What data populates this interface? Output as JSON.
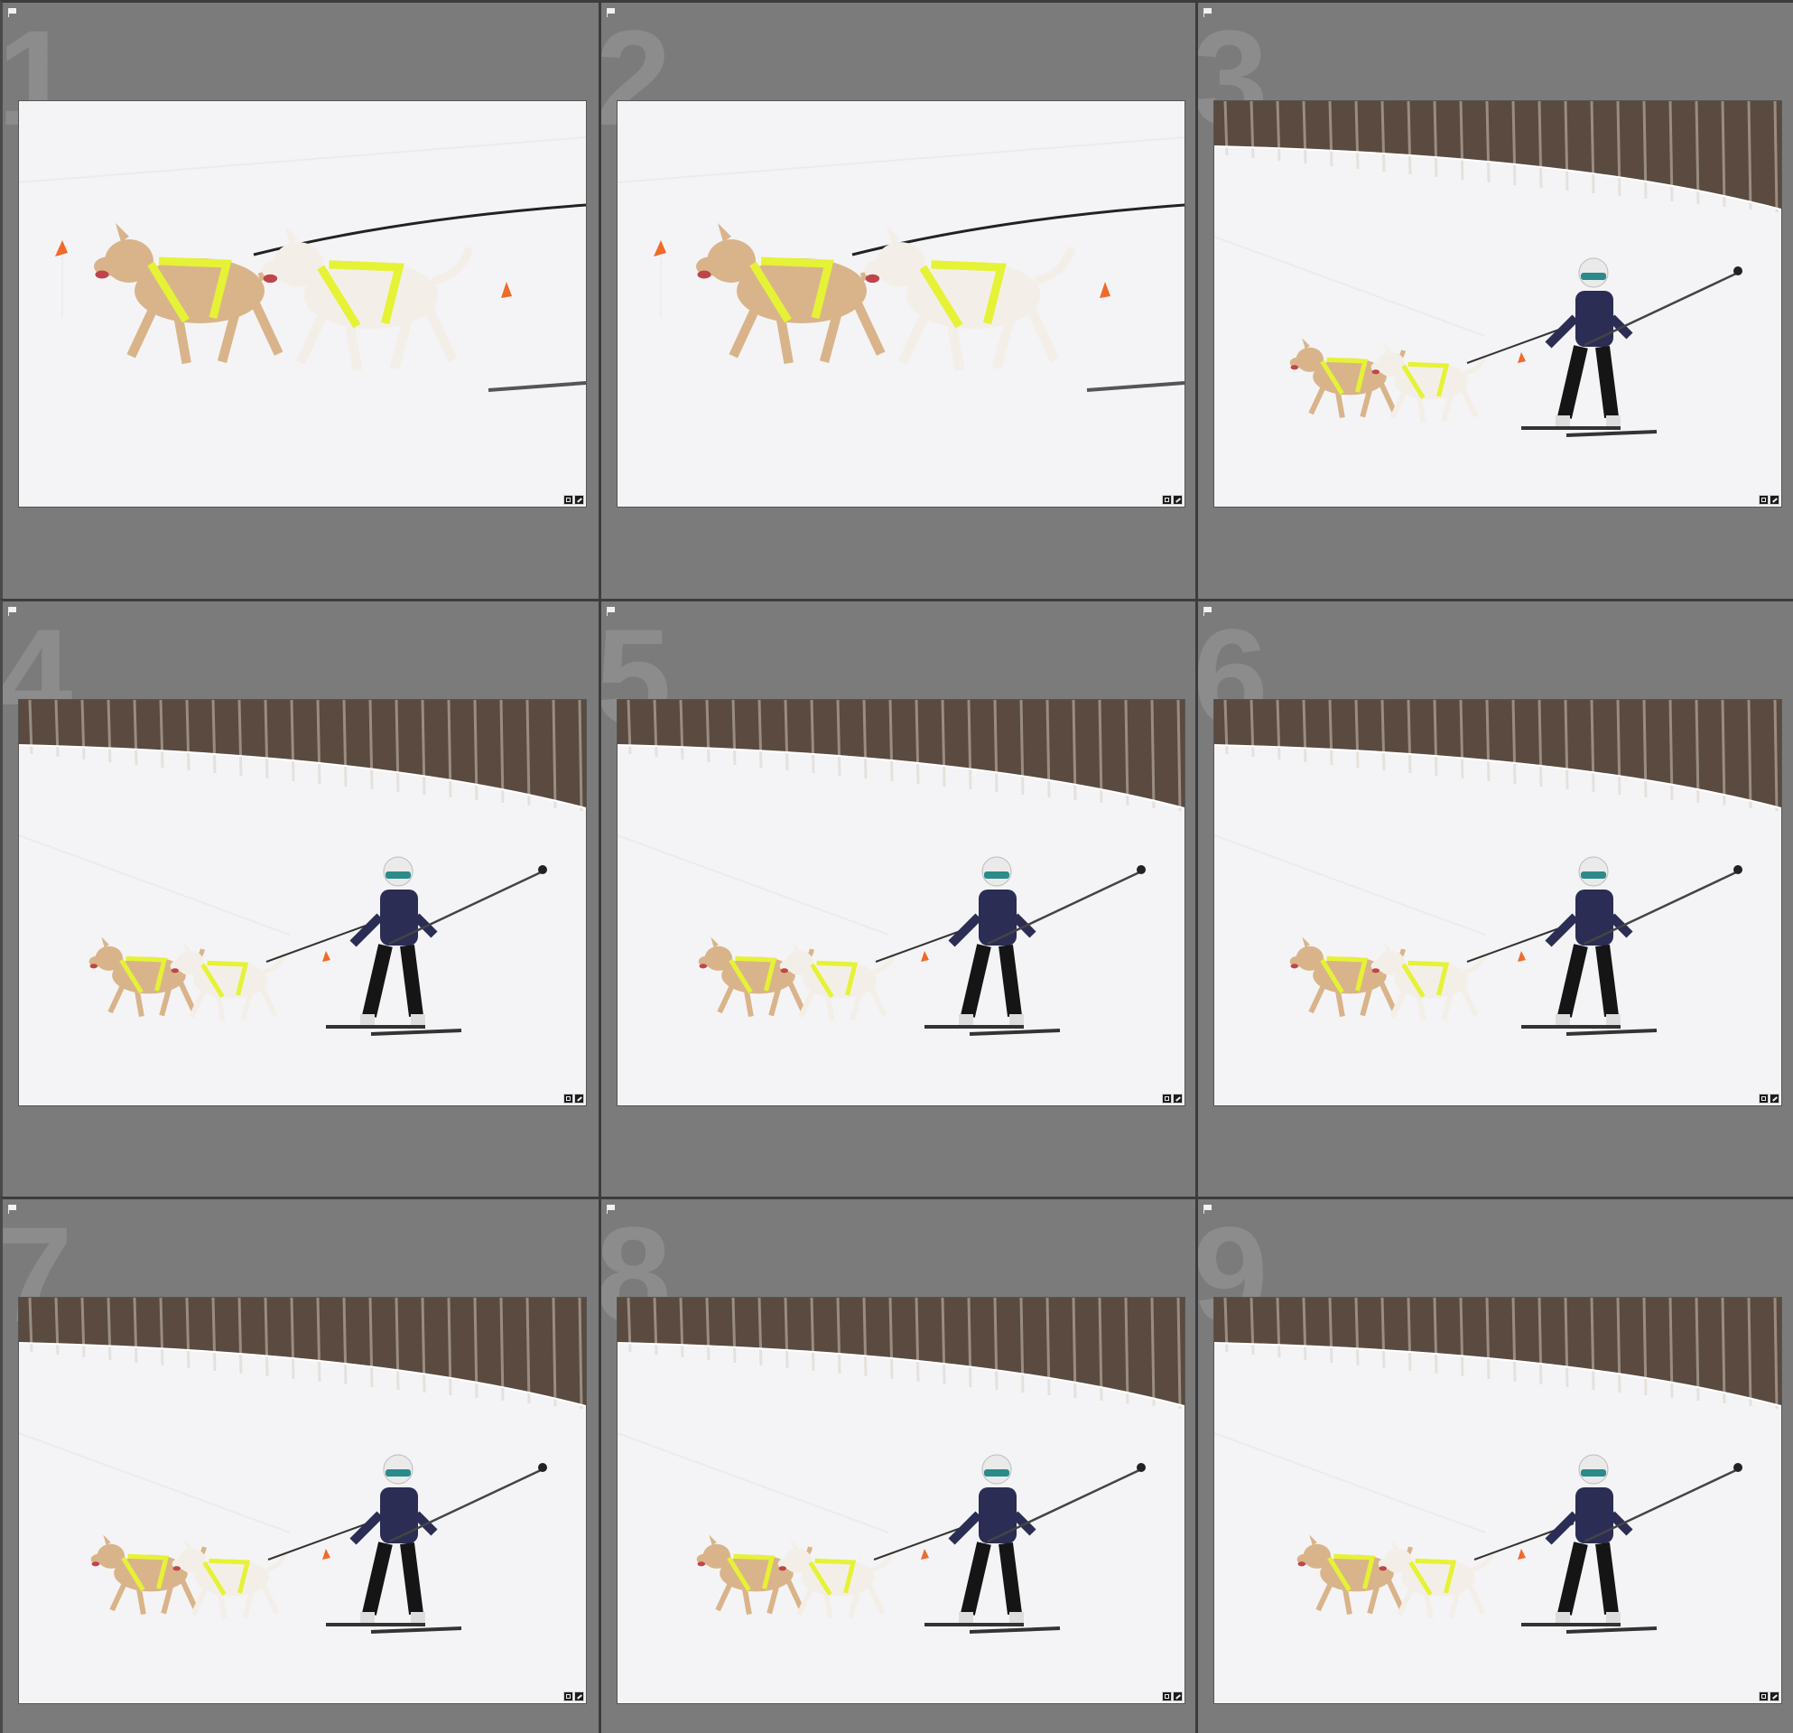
{
  "grid": {
    "cells": [
      {
        "index": "1",
        "scene": "closeup",
        "frame": 0
      },
      {
        "index": "2",
        "scene": "closeup",
        "frame": 1
      },
      {
        "index": "3",
        "scene": "skier",
        "frame": 0
      },
      {
        "index": "4",
        "scene": "skier",
        "frame": 1
      },
      {
        "index": "5",
        "scene": "skier",
        "frame": 2
      },
      {
        "index": "6",
        "scene": "skier",
        "frame": 3
      },
      {
        "index": "7",
        "scene": "skier",
        "frame": 4
      },
      {
        "index": "8",
        "scene": "skier",
        "frame": 5
      },
      {
        "index": "9",
        "scene": "skier",
        "frame": 6
      }
    ]
  },
  "colors": {
    "panel": "#7b7b7b",
    "gutter": "#3c3c3c",
    "snow": "#f4f4f6",
    "trees": "#5a4a40",
    "dog_tan": "#d9b48a",
    "dog_white": "#f3efe8",
    "harness": "#e6f236",
    "jacket": "#2b2d55",
    "marker": "#f06a2a"
  },
  "icons": {
    "pick_flag": "flag-icon",
    "badges": [
      "crop-badge-icon",
      "edit-badge-icon"
    ]
  }
}
